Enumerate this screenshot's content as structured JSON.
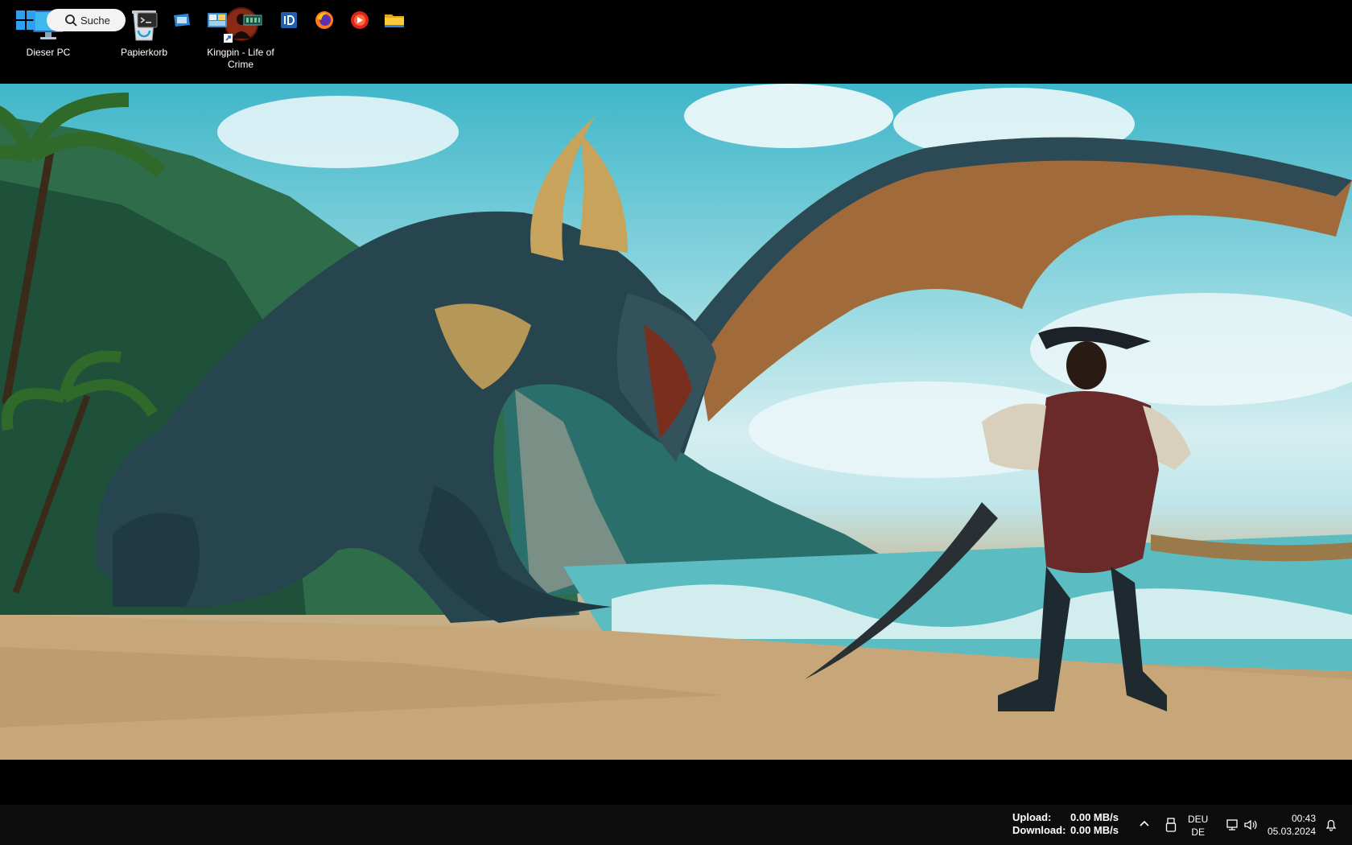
{
  "desktop": {
    "icons": [
      {
        "label": "Dieser PC",
        "icon": "monitor-icon"
      },
      {
        "label": "Papierkorb",
        "icon": "recycle-bin-icon"
      },
      {
        "label": "Kingpin - Life of Crime",
        "icon": "kingpin-shortcut-icon"
      }
    ]
  },
  "taskbar": {
    "search_label": "Suche",
    "apps": [
      "terminal-icon",
      "app-window-icon",
      "control-panel-icon",
      "hardware-monitor-icon",
      "id-app-icon",
      "firefox-icon",
      "media-player-icon",
      "file-explorer-icon"
    ],
    "network_stats": {
      "upload_label": "Upload:",
      "upload_value": "0.00 MB/s",
      "download_label": "Download:",
      "download_value": "0.00 MB/s"
    },
    "language": {
      "top": "DEU",
      "bottom": "DE"
    },
    "clock": {
      "time": "00:43",
      "date": "05.03.2024"
    }
  }
}
